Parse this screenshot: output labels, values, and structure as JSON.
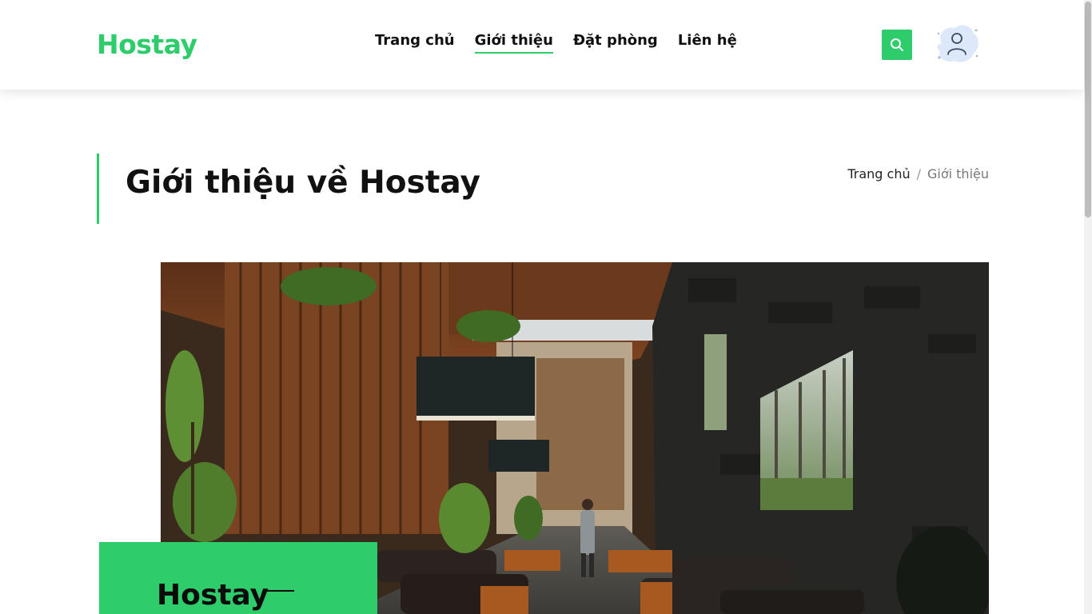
{
  "header": {
    "logo": "Hostay",
    "nav": [
      {
        "label": "Trang chủ",
        "active": false
      },
      {
        "label": "Giới thiệu",
        "active": true
      },
      {
        "label": "Đặt phòng",
        "active": false
      },
      {
        "label": "Liên hệ",
        "active": false
      }
    ],
    "search_icon": "search-icon",
    "avatar_icon": "user-avatar-icon"
  },
  "page": {
    "title": "Giới thiệu về Hostay",
    "breadcrumb": {
      "home": "Trang chủ",
      "separator": "/",
      "current": "Giới thiệu"
    }
  },
  "hero": {
    "card_title": "Hostay"
  },
  "colors": {
    "accent": "#2ecc6a",
    "text": "#111111"
  }
}
